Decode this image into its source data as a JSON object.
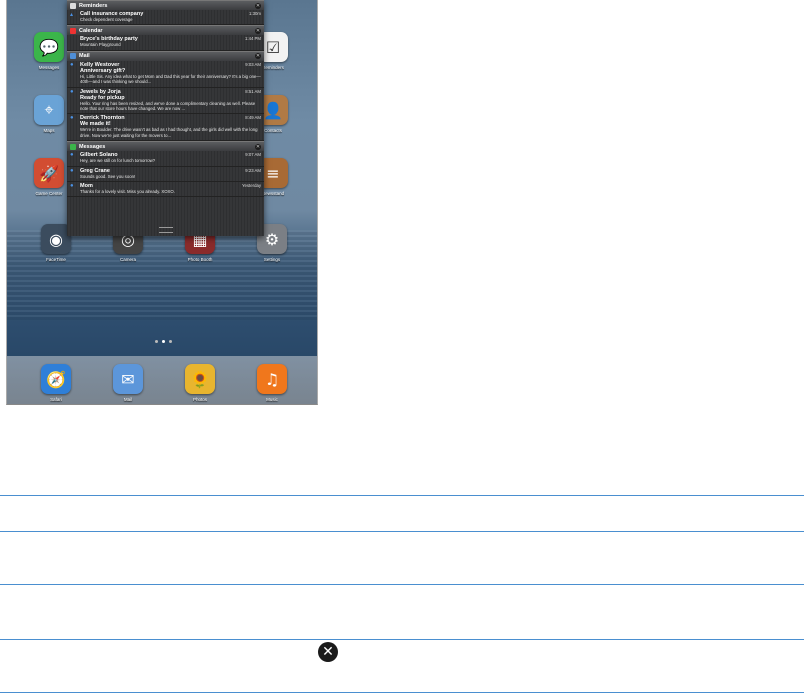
{
  "notification_center": {
    "sections": [
      {
        "title": "Reminders",
        "icon": "reminders-icon",
        "items": [
          {
            "title": "Call insurance company",
            "time": "1:30m",
            "text": "Check dependent coverage"
          }
        ]
      },
      {
        "title": "Calendar",
        "icon": "calendar-icon",
        "items": [
          {
            "title": "Bryce's birthday party",
            "time": "1:44 PM",
            "text": "Mountain Playground"
          }
        ]
      },
      {
        "title": "Mail",
        "icon": "mail-icon",
        "items": [
          {
            "title": "Kelly Westover",
            "time": "9:03 AM",
            "subtitle": "Anniversary gift?",
            "text": "Hi, Little Sis. Any idea what to get Mom and Dad this year for their anniversary? It's a big one—40th—and I was thinking we should..."
          },
          {
            "title": "Jewels by Jorja",
            "time": "8:51 AM",
            "subtitle": "Ready for pickup",
            "text": "Hello. Your ring has been resized, and we've done a complimentary cleaning as well. Please note that our store hours have changed. We are now ..."
          },
          {
            "title": "Derrick Thornton",
            "time": "8:49 AM",
            "subtitle": "We made it!",
            "text": "We're in Boulder. The drive wasn't as bad as I had thought, and the girls did well with the long drive. Now we're just waiting for the movers to..."
          }
        ]
      },
      {
        "title": "Messages",
        "icon": "messages-icon",
        "items": [
          {
            "title": "Gilbert Solano",
            "time": "9:07 AM",
            "text": "Hey, are we still on for lunch tomorrow?"
          },
          {
            "title": "Greg Crane",
            "time": "9:23 AM",
            "text": "Sounds good. See you soon!"
          },
          {
            "title": "Mom",
            "time": "Yesterday",
            "text": "Thanks for a lovely visit. Miss you already. XOXO."
          }
        ]
      }
    ]
  },
  "home_apps": {
    "partial_left": [
      {
        "label": "Messages",
        "icon": "messages-app-icon",
        "color": "#3bb54a"
      },
      {
        "label": "Maps",
        "icon": "maps-app-icon",
        "color": "#6aa3d6"
      },
      {
        "label": "Game Center",
        "icon": "game-center-app-icon",
        "color": "#d24d32"
      }
    ],
    "partial_right": [
      {
        "label": "Reminders",
        "icon": "reminders-app-icon",
        "color": "#f2f2f2"
      },
      {
        "label": "Contacts",
        "icon": "contacts-app-icon",
        "color": "#b07a45"
      },
      {
        "label": "Newsstand",
        "icon": "newsstand-app-icon",
        "color": "#a86a35"
      }
    ],
    "row": [
      {
        "label": "FaceTime",
        "icon": "facetime-app-icon",
        "color": "#3b4c5e"
      },
      {
        "label": "Camera",
        "icon": "camera-app-icon",
        "color": "#444444"
      },
      {
        "label": "Photo Booth",
        "icon": "photo-booth-app-icon",
        "color": "#8a2b2b"
      },
      {
        "label": "Settings",
        "icon": "settings-app-icon",
        "color": "#7b7f85"
      }
    ],
    "dock": [
      {
        "label": "Safari",
        "icon": "safari-app-icon",
        "color": "#2f7fd8"
      },
      {
        "label": "Mail",
        "icon": "mail-app-icon",
        "color": "#5c96da"
      },
      {
        "label": "Photos",
        "icon": "photos-app-icon",
        "color": "#e8b52f"
      },
      {
        "label": "Music",
        "icon": "music-app-icon",
        "color": "#f0771c"
      }
    ]
  },
  "page_indicator": {
    "pages": 3,
    "current": 2
  },
  "close_icon": {
    "name": "close-icon",
    "glyph": "✕"
  }
}
